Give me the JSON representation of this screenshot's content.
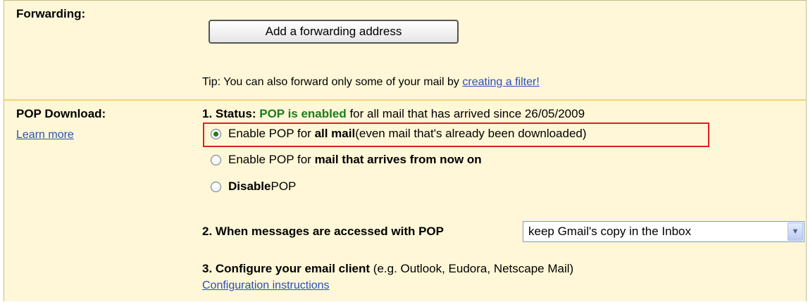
{
  "forwarding": {
    "label": "Forwarding:",
    "add_button": "Add a forwarding address",
    "tip_prefix": "Tip: You can also forward only some of your mail by ",
    "tip_link": "creating a filter!"
  },
  "pop": {
    "label": "POP Download:",
    "learn_more": "Learn more",
    "status_label": "1. Status: ",
    "status_value": "POP is enabled",
    "status_suffix": " for all mail that has arrived since 26/05/2009",
    "options": [
      {
        "prefix": "Enable POP for ",
        "bold": "all mail",
        "suffix": " (even mail that's already been downloaded)",
        "selected": true
      },
      {
        "prefix": "Enable POP for ",
        "bold": "mail that arrives from now on",
        "suffix": "",
        "selected": false
      },
      {
        "prefix": "",
        "bold": "Disable",
        "suffix": " POP",
        "selected": false
      }
    ],
    "access_label": "2. When messages are accessed with POP",
    "access_select_value": "keep Gmail's  copy in the Inbox",
    "config_label": "3. Configure your email client",
    "config_suffix": " (e.g. Outlook, Eudora, Netscape Mail)",
    "config_link": "Configuration instructions"
  },
  "colors": {
    "panel_bg": "#fff7d7",
    "status_green": "#1b7d1b",
    "link_blue": "#2a4fb8",
    "highlight_red": "#e02020"
  }
}
